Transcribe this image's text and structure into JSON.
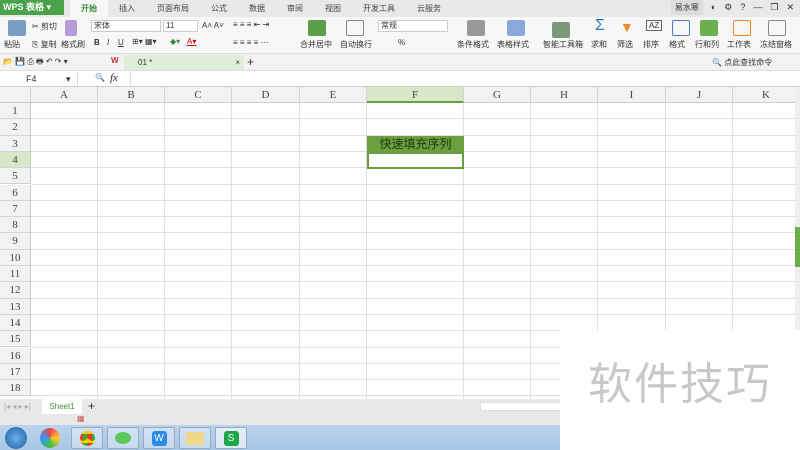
{
  "app": {
    "logo": "WPS 表格"
  },
  "tabs": [
    "开始",
    "插入",
    "页面布局",
    "公式",
    "数据",
    "审阅",
    "视图",
    "开发工具",
    "云服务"
  ],
  "user": "易水寒",
  "ribbon": {
    "paste": "粘贴",
    "cut": "剪切",
    "copy": "复制",
    "format_painter": "格式刷",
    "font": "宋体",
    "size": "11",
    "bold": "B",
    "italic": "I",
    "underline": "U",
    "merge": "合并居中",
    "wrap": "自动换行",
    "number_format": "常规",
    "percent": "%",
    "conditional": "条件格式",
    "table_style": "表格样式",
    "smart": "智能工具箱",
    "sum": "求和",
    "filter": "筛选",
    "sort": "排序",
    "format": "格式",
    "rowcol": "行和列",
    "sheet": "工作表",
    "freeze": "冻结窗格",
    "search": "点此查找命令"
  },
  "doc_tab": "01 *",
  "formula": {
    "namebox": "F4",
    "fx": "fx"
  },
  "columns": [
    "A",
    "B",
    "C",
    "D",
    "E",
    "F",
    "G",
    "H",
    "I",
    "J",
    "K"
  ],
  "rows": [
    "1",
    "2",
    "3",
    "4",
    "5",
    "6",
    "7",
    "8",
    "9",
    "10",
    "11",
    "12",
    "13",
    "14",
    "15",
    "16",
    "17",
    "18"
  ],
  "cells": {
    "F3": "快速填充序列"
  },
  "sheet_tab": "Sheet1",
  "watermark": "软件技巧",
  "colors": {
    "accent": "#6a9e3f",
    "logo": "#4aa24a"
  }
}
